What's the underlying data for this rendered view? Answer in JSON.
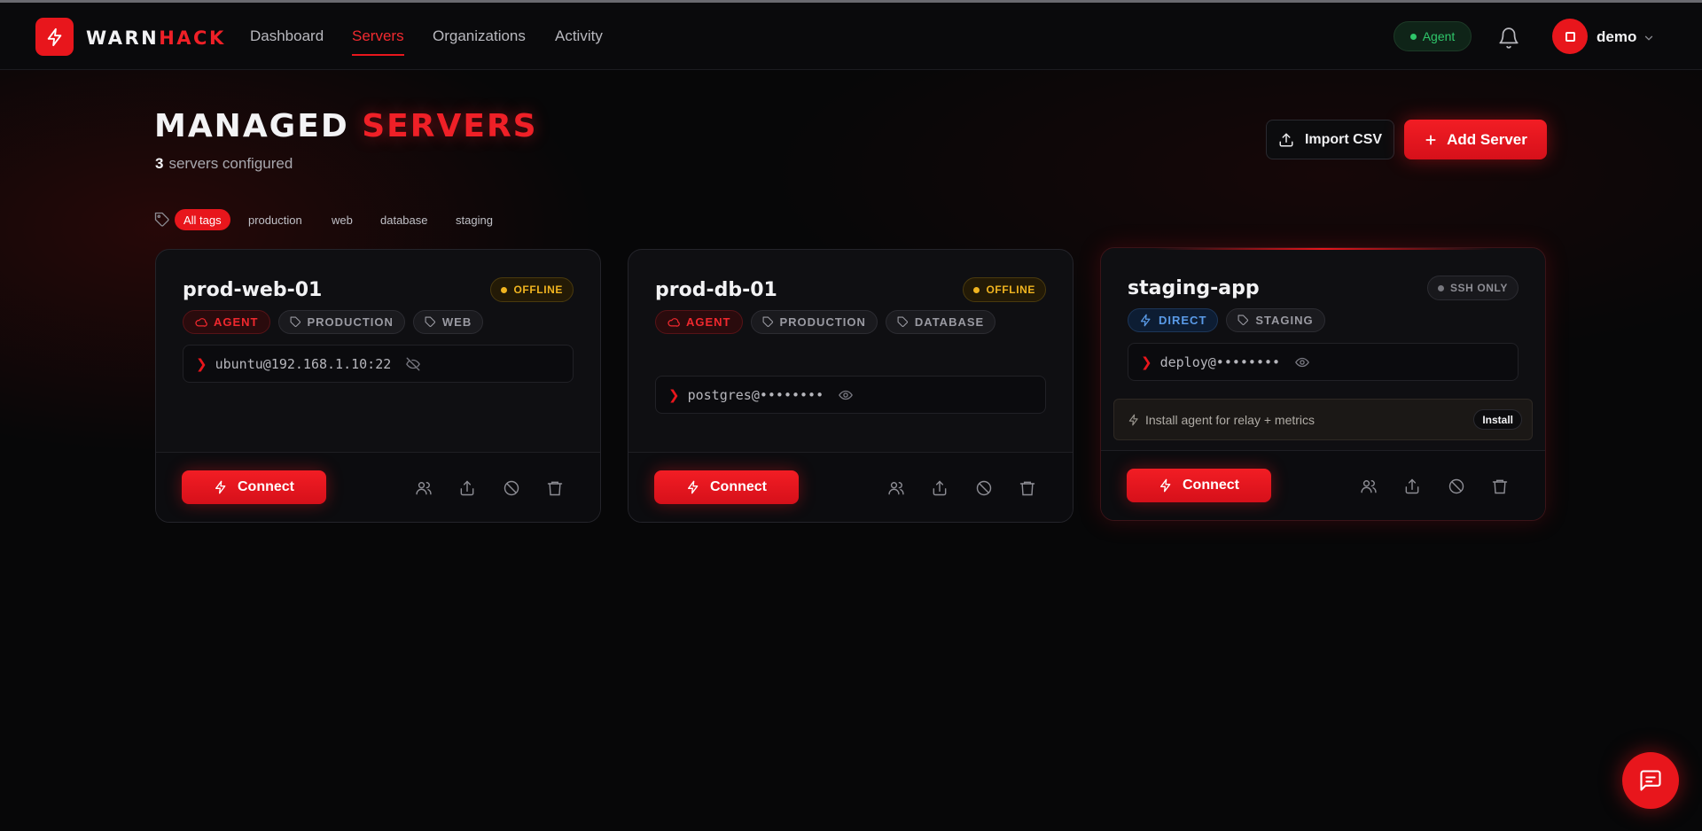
{
  "brand": {
    "name_part1": "WARN",
    "name_part2": "HACK",
    "accent": "#e8161c"
  },
  "nav": {
    "links": [
      "Dashboard",
      "Servers",
      "Organizations",
      "Activity"
    ],
    "active": "Servers",
    "agent_label": "Agent",
    "user": "demo"
  },
  "header": {
    "title_part1": "MANAGED",
    "title_part2": "SERVERS",
    "count": "3",
    "count_suffix": "servers configured",
    "import_label": "Import CSV",
    "add_label": "Add Server"
  },
  "tag_filters": [
    "All tags",
    "production",
    "web",
    "database",
    "staging"
  ],
  "servers": [
    {
      "name": "prod-web-01",
      "status": "OFFLINE",
      "mode": "AGENT",
      "tags": [
        "PRODUCTION",
        "WEB"
      ],
      "connection": "ubuntu@192.168.1.10:22",
      "connect_label": "Connect"
    },
    {
      "name": "prod-db-01",
      "status": "OFFLINE",
      "mode": "AGENT",
      "tags": [
        "PRODUCTION",
        "DATABASE"
      ],
      "connection": "postgres@••••••••",
      "connect_label": "Connect"
    },
    {
      "name": "staging-app",
      "status": "SSH ONLY",
      "mode": "DIRECT",
      "tags": [
        "STAGING"
      ],
      "connection": "deploy@••••••••",
      "install_text": "Install agent for relay + metrics",
      "install_label": "Install",
      "connect_label": "Connect"
    }
  ],
  "icons": {
    "logo": "bolt-icon",
    "bell": "bell-icon",
    "chat": "chat-icon",
    "card_actions": [
      "users-icon",
      "share-icon",
      "block-icon",
      "trash-icon"
    ]
  }
}
